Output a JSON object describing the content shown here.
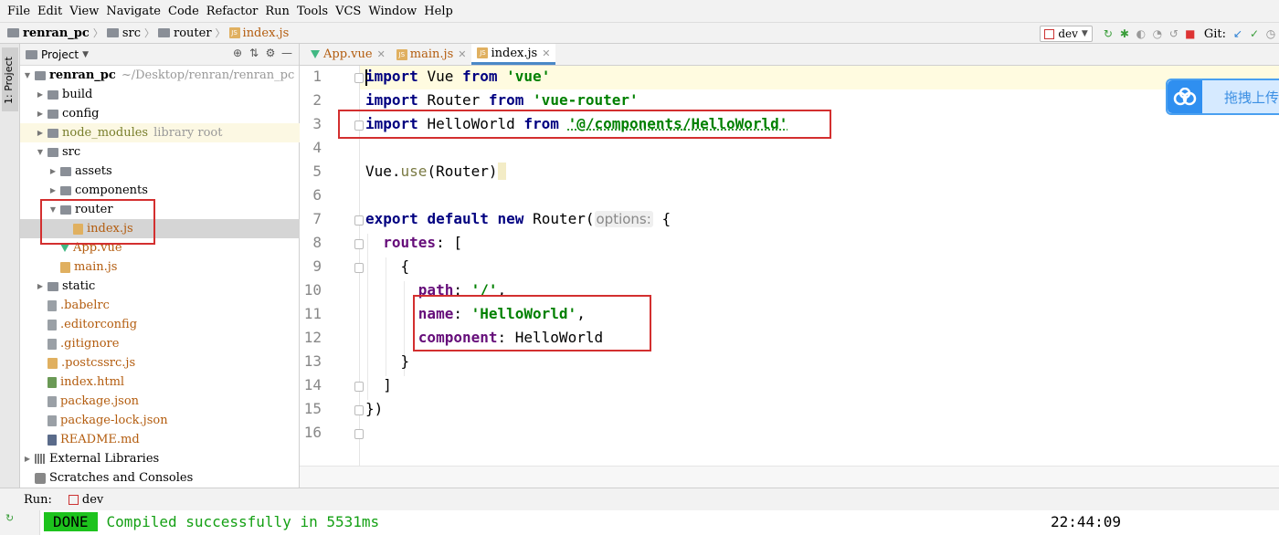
{
  "menu": [
    "File",
    "Edit",
    "View",
    "Navigate",
    "Code",
    "Refactor",
    "Run",
    "Tools",
    "VCS",
    "Window",
    "Help"
  ],
  "breadcrumb": {
    "project": "renran_pc",
    "folder1": "src",
    "folder2": "router",
    "file": "index.js"
  },
  "toolbar": {
    "run_config": "dev",
    "git_label": "Git:"
  },
  "left_strip": {
    "project_tab": "1: Project"
  },
  "project_panel": {
    "title": "Project",
    "tree": [
      {
        "label": "renran_pc",
        "suffix": "~/Desktop/renran/renran_pc"
      },
      {
        "label": "build"
      },
      {
        "label": "config"
      },
      {
        "label": "node_modules",
        "suffix": "library root"
      },
      {
        "label": "src"
      },
      {
        "label": "assets"
      },
      {
        "label": "components"
      },
      {
        "label": "router"
      },
      {
        "label": "index.js"
      },
      {
        "label": "App.vue"
      },
      {
        "label": "main.js"
      },
      {
        "label": "static"
      },
      {
        "label": ".babelrc"
      },
      {
        "label": ".editorconfig"
      },
      {
        "label": ".gitignore"
      },
      {
        "label": ".postcssrc.js"
      },
      {
        "label": "index.html"
      },
      {
        "label": "package.json"
      },
      {
        "label": "package-lock.json"
      },
      {
        "label": "README.md"
      },
      {
        "label": "External Libraries"
      },
      {
        "label": "Scratches and Consoles"
      }
    ]
  },
  "editor": {
    "tabs": [
      {
        "label": "App.vue"
      },
      {
        "label": "main.js"
      },
      {
        "label": "index.js"
      }
    ],
    "line_numbers": [
      "1",
      "2",
      "3",
      "4",
      "5",
      "6",
      "7",
      "8",
      "9",
      "10",
      "11",
      "12",
      "13",
      "14",
      "15",
      "16"
    ],
    "code": {
      "kw_import": "import",
      "kw_from": "from",
      "vue": "Vue",
      "vue_str": "'vue'",
      "router": "Router",
      "router_str": "'vue-router'",
      "helloworld": "HelloWorld",
      "helloworld_str": "'@/components/HelloWorld'",
      "vue_use_prefix": "Vue.",
      "use": "use",
      "use_args": "(Router)",
      "kw_export": "export",
      "kw_default": "default",
      "kw_new": "new",
      "router_call": "Router(",
      "hint_options": "options:",
      "open_brace": " {",
      "routes": "routes",
      "routes_rest": ": [",
      "obj_open": "{",
      "path": "path",
      "path_val": "'/'",
      "name": "name",
      "name_val": "'HelloWorld'",
      "component": "component",
      "component_val": ": HelloWorld",
      "obj_close": "}",
      "arr_close": "]",
      "end": "})",
      "colon": ": ",
      "comma": ","
    }
  },
  "float_widget": {
    "label": "拖拽上传"
  },
  "run_panel": {
    "label": "Run:",
    "config": "dev",
    "status": "DONE",
    "message": "Compiled successfully in 5531ms",
    "time": "22:44:09"
  },
  "colors": {
    "keyword": "#000080",
    "string": "#008000",
    "property": "#660e7a",
    "highlight_box": "#d32f2f",
    "done_badge": "#1dc31d"
  }
}
